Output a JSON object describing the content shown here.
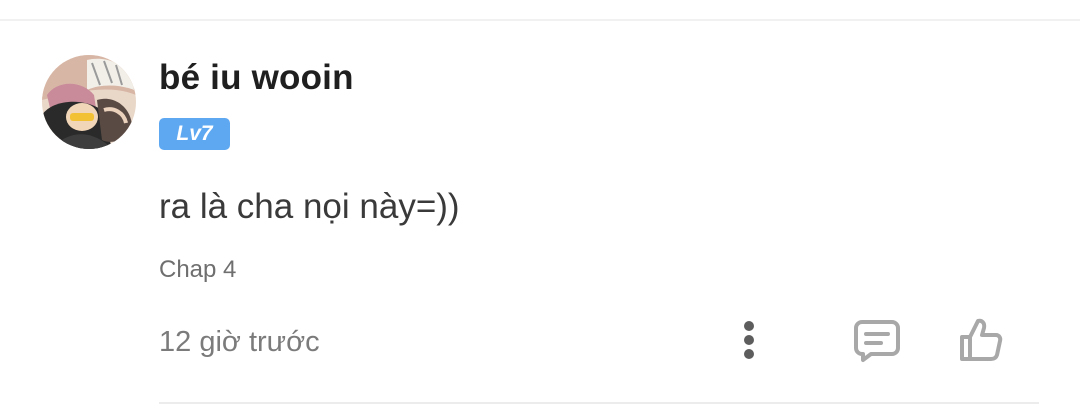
{
  "comment": {
    "username": "bé iu wooin",
    "level": "Lv7",
    "text": "ra là cha nọi này=))",
    "chapter": "Chap 4",
    "timestamp": "12 giờ trước"
  },
  "actions": {
    "more_icon": "more-vertical-icon",
    "reply_icon": "comment-icon",
    "like_icon": "thumbs-up-icon"
  },
  "colors": {
    "level_badge": "#5ea8f2",
    "username": "#1f1f1f",
    "body_text": "#3a3a3a",
    "muted_text": "#7b7b7b",
    "icon": "#a8a8a8"
  }
}
